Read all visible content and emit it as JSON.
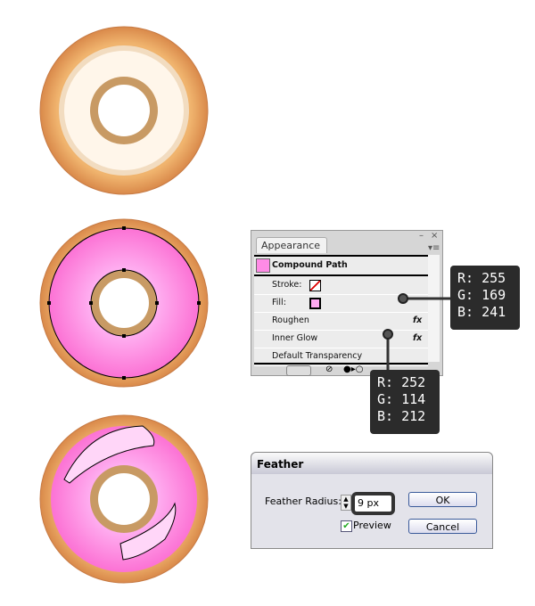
{
  "colors": {
    "pink_fill": "#ffa9f1",
    "pink_glow": "#fc72d4",
    "dough": "#e8a562",
    "icing_white": "#fff6ea"
  },
  "appearance": {
    "tab_label": "Appearance",
    "tab_close": "×",
    "minimize": "–",
    "close": "×",
    "menu": "▾≡",
    "header": "Compound Path",
    "rows": [
      {
        "label": "Stroke:"
      },
      {
        "label": "Fill:"
      },
      {
        "label": "Roughen",
        "fx": "fx"
      },
      {
        "label": "Inner Glow",
        "fx": "fx"
      },
      {
        "label": "Default Transparency"
      }
    ]
  },
  "tooltips": [
    {
      "r": "R: 255",
      "g": "G: 169",
      "b": "B: 241"
    },
    {
      "r": "R: 252",
      "g": "G: 114",
      "b": "B: 212"
    }
  ],
  "feather": {
    "title": "Feather",
    "radius_label": "Feather Radius:",
    "radius_value": "9 px",
    "preview_label": "Preview",
    "preview_checked": true,
    "ok": "OK",
    "cancel": "Cancel"
  }
}
